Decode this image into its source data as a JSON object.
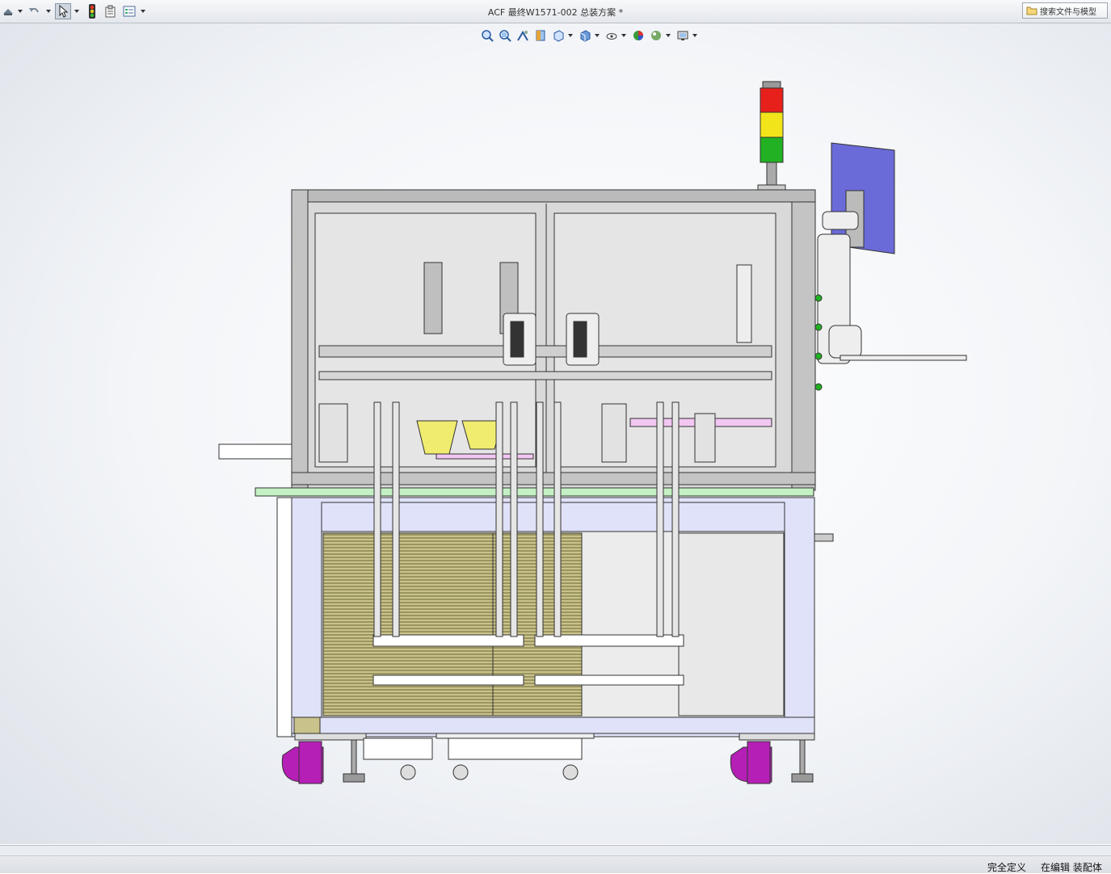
{
  "window": {
    "title": "ACF 最终W1571-002 总装方案 *"
  },
  "search": {
    "label": "搜索文件与模型"
  },
  "toolbar": {
    "items": [
      "rebuild-icon",
      "undo-icon",
      "select-icon",
      "traffic-light-icon",
      "file-properties-icon",
      "options-icon"
    ]
  },
  "view_hud": {
    "items": [
      "zoom-to-fit-icon",
      "zoom-to-area-icon",
      "previous-view-icon",
      "section-view-icon",
      "view-orientation-icon",
      "display-style-icon",
      "hide-show-items-icon",
      "edit-appearance-icon",
      "apply-scene-icon",
      "view-settings-icon"
    ]
  },
  "status": {
    "definition": "完全定义",
    "mode": "在编辑 装配体"
  },
  "model": {
    "stack_light_colors": [
      "#e8201c",
      "#f2e41a",
      "#22b122"
    ],
    "monitor_color": "#6a6ad8",
    "caster_color": "#b51fb5",
    "cabinet_color": "#dfe2f8",
    "tabletop_color": "#c4f0c4"
  }
}
